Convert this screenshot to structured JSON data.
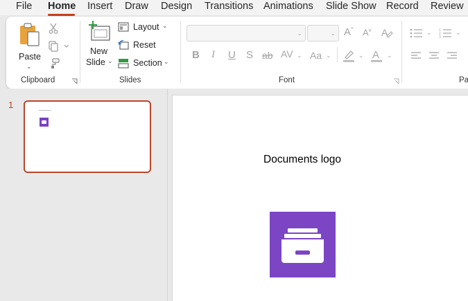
{
  "tabs": [
    {
      "label": "File"
    },
    {
      "label": "Home",
      "active": true
    },
    {
      "label": "Insert"
    },
    {
      "label": "Draw"
    },
    {
      "label": "Design"
    },
    {
      "label": "Transitions"
    },
    {
      "label": "Animations"
    },
    {
      "label": "Slide Show"
    },
    {
      "label": "Record"
    },
    {
      "label": "Review"
    }
  ],
  "ribbon": {
    "clipboard": {
      "paste_label": "Paste",
      "group_label": "Clipboard"
    },
    "slides": {
      "new_label": "New",
      "slide_label": "Slide",
      "layout_label": "Layout",
      "reset_label": "Reset",
      "section_label": "Section",
      "group_label": "Slides"
    },
    "font": {
      "group_label": "Font",
      "font_name_value": "",
      "font_size_value": "",
      "bold": "B",
      "italic": "I",
      "underline": "U",
      "shadow": "S",
      "strikethrough": "ab",
      "spacing": "AV",
      "change_case": "Aa"
    },
    "paragraph": {
      "group_label": "Pa"
    }
  },
  "thumbnails": [
    {
      "number": "1",
      "selected": true
    }
  ],
  "slide": {
    "title": "Documents logo",
    "logo_icon": "file-cabinet-drawer-icon",
    "logo_color": "#7b45c4"
  },
  "colors": {
    "accent": "#c43e1c",
    "selection_border": "#b7472a",
    "logo_purple": "#7b45c4"
  }
}
